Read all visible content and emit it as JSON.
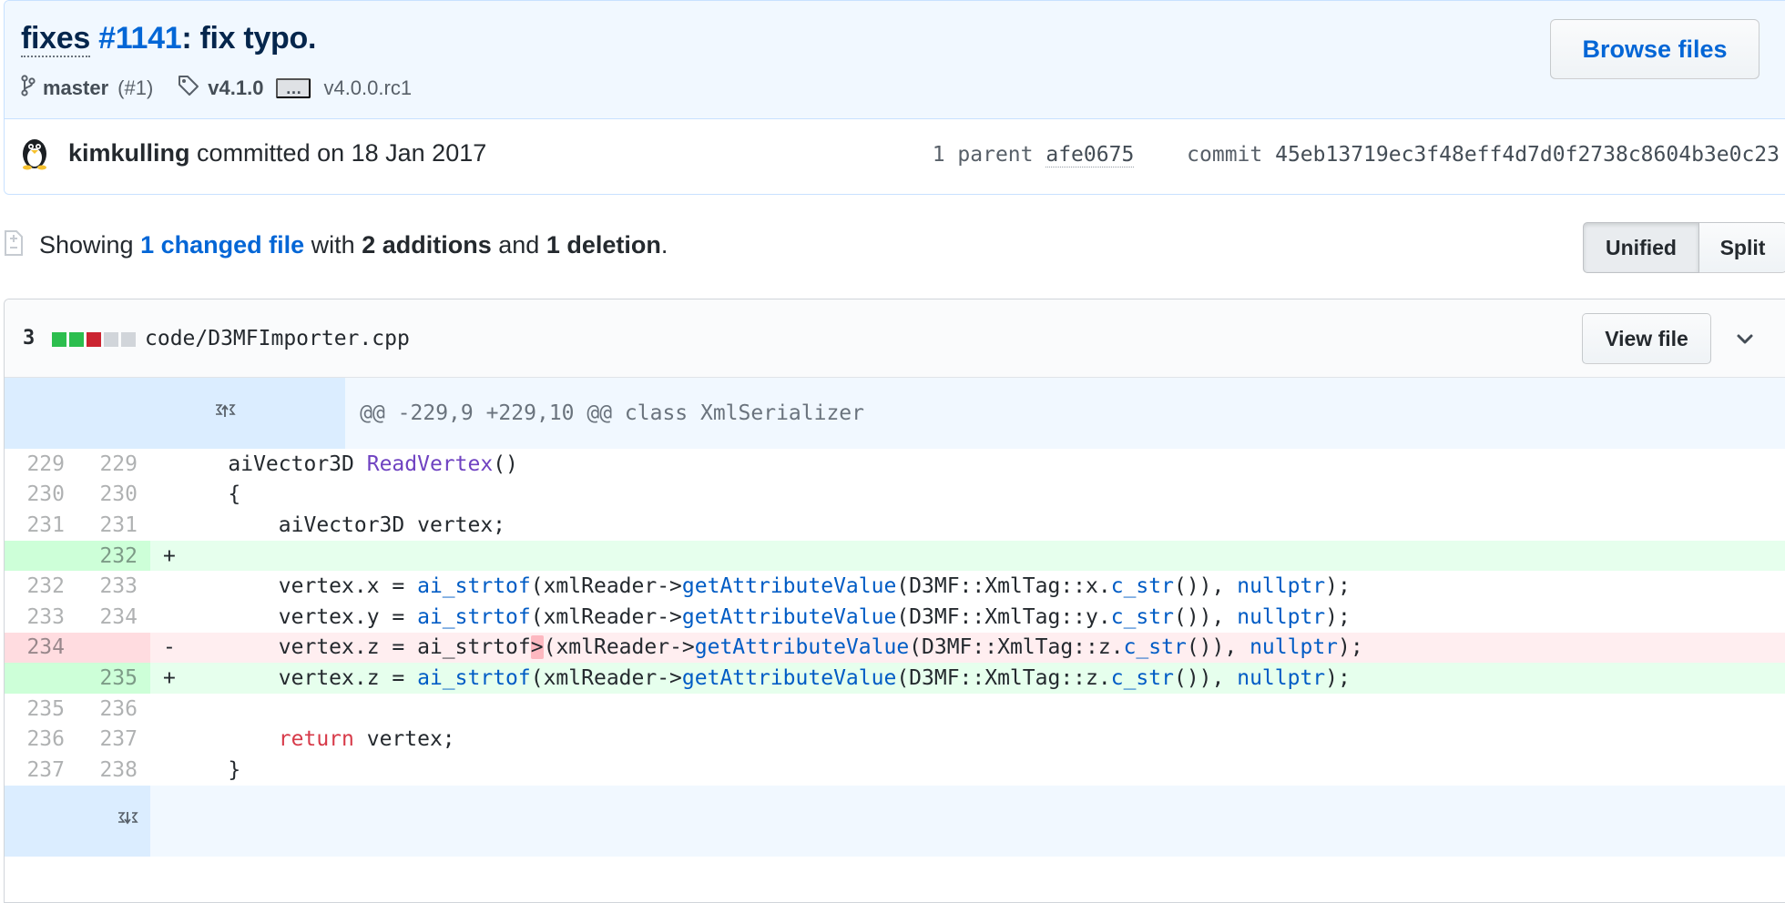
{
  "commit": {
    "title_prefix": "fixes",
    "issue_ref": "#1141",
    "title_suffix": ": fix typo.",
    "branch": "master",
    "branch_count": "(#1)",
    "tag_primary": "v4.1.0",
    "tag_ellipsis": "…",
    "tag_secondary": "v4.0.0.rc1",
    "browse_label": "Browse files",
    "author": "kimkulling",
    "committed_text": "committed on 18 Jan 2017",
    "parent_label": "1 parent",
    "parent_sha": "afe0675",
    "commit_label": "commit",
    "full_sha": "45eb13719ec3f48eff4d7d0f2738c8604b3e0c23"
  },
  "toc": {
    "showing": "Showing",
    "changed_link": "1 changed file",
    "with": "with",
    "additions": "2 additions",
    "and": "and",
    "deletions": "1 deletion",
    "period": ".",
    "unified_label": "Unified",
    "split_label": "Split"
  },
  "file": {
    "change_count": "3",
    "diffstat": [
      "added",
      "added",
      "deleted",
      "neutral",
      "neutral"
    ],
    "path": "code/D3MFImporter.cpp",
    "view_label": "View file",
    "hunk_header": "@@ -229,9 +229,10 @@ class XmlSerializer",
    "lines": [
      {
        "type": "context",
        "old": "229",
        "new": "229",
        "sign": " "
      },
      {
        "type": "context",
        "old": "230",
        "new": "230",
        "sign": " "
      },
      {
        "type": "context",
        "old": "231",
        "new": "231",
        "sign": " "
      },
      {
        "type": "add",
        "old": "",
        "new": "232",
        "sign": "+"
      },
      {
        "type": "context",
        "old": "232",
        "new": "233",
        "sign": " "
      },
      {
        "type": "context",
        "old": "233",
        "new": "234",
        "sign": " "
      },
      {
        "type": "del",
        "old": "234",
        "new": "",
        "sign": "-"
      },
      {
        "type": "add",
        "old": "",
        "new": "235",
        "sign": "+"
      },
      {
        "type": "context",
        "old": "235",
        "new": "236",
        "sign": " "
      },
      {
        "type": "context",
        "old": "236",
        "new": "237",
        "sign": " "
      },
      {
        "type": "context",
        "old": "237",
        "new": "238",
        "sign": " "
      }
    ],
    "code": {
      "l0": {
        "a": "    aiVector3D ",
        "fn": "ReadVertex",
        "b": "()"
      },
      "l1": "    {",
      "l2": "        aiVector3D vertex;",
      "l3": "",
      "l4": {
        "pre": "        vertex.x = ",
        "f1": "ai_strtof",
        "m1": "(xmlReader->",
        "f2": "getAttributeValue",
        "m2": "(D3MF::XmlTag::x.",
        "f3": "c_str",
        "m3": "()), ",
        "f4": "nullptr",
        "post": ");"
      },
      "l5": {
        "pre": "        vertex.y = ",
        "f1": "ai_strtof",
        "m1": "(xmlReader->",
        "f2": "getAttributeValue",
        "m2": "(D3MF::XmlTag::y.",
        "f3": "c_str",
        "m3": "()), ",
        "f4": "nullptr",
        "post": ");"
      },
      "l6": {
        "pre": "        vertex.z = ai_strtof",
        "hl": ">",
        "m1": "(xmlReader->",
        "f2": "getAttributeValue",
        "m2": "(D3MF::XmlTag::z.",
        "f3": "c_str",
        "m3": "()), ",
        "f4": "nullptr",
        "post": ");"
      },
      "l7": {
        "pre": "        vertex.z = ",
        "f1": "ai_strtof",
        "m1": "(xmlReader->",
        "f2": "getAttributeValue",
        "m2": "(D3MF::XmlTag::z.",
        "f3": "c_str",
        "m3": "()), ",
        "f4": "nullptr",
        "post": ");"
      },
      "l8": "",
      "l9": {
        "pre": "        ",
        "kw": "return",
        "post": " vertex;"
      },
      "l10": "    }"
    }
  },
  "colors": {
    "link": "#0366d6",
    "added": "#2cbe4e",
    "deleted": "#cb2431",
    "neutral": "#d1d5da"
  },
  "icons": [
    "git-branch-icon",
    "tag-icon",
    "avatar",
    "file-diff-icon",
    "expand-up-icon",
    "expand-down-icon",
    "chevron-down-icon"
  ]
}
